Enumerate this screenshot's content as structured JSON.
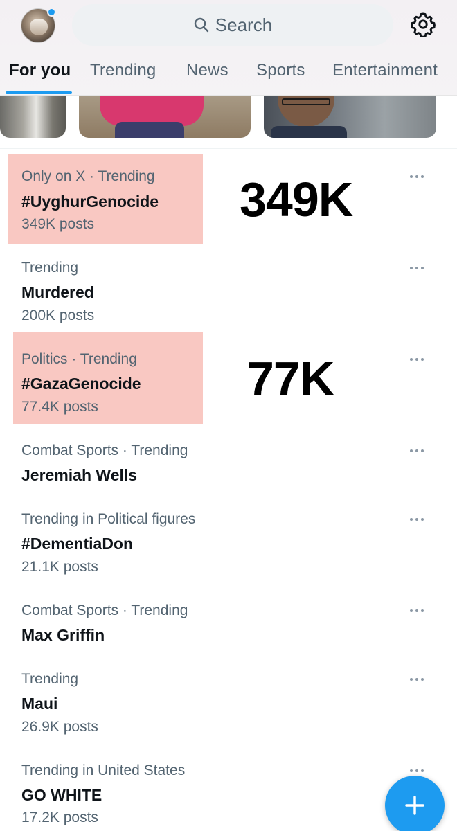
{
  "search": {
    "placeholder": "Search"
  },
  "tabs": [
    {
      "label": "For you",
      "active": true
    },
    {
      "label": "Trending",
      "active": false
    },
    {
      "label": "News",
      "active": false
    },
    {
      "label": "Sports",
      "active": false
    },
    {
      "label": "Entertainment",
      "active": false
    }
  ],
  "trends": [
    {
      "context": "Only on X · Trending",
      "topic": "#UyghurGenocide",
      "count": "349K posts",
      "highlighted": true
    },
    {
      "context": "Trending",
      "topic": "Murdered",
      "count": "200K posts",
      "highlighted": false
    },
    {
      "context": "Politics · Trending",
      "topic": "#GazaGenocide",
      "count": "77.4K posts",
      "highlighted": true
    },
    {
      "context": "Combat Sports · Trending",
      "topic": "Jeremiah Wells",
      "count": "",
      "highlighted": false
    },
    {
      "context": "Trending in Political figures",
      "topic": "#DementiaDon",
      "count": "21.1K posts",
      "highlighted": false
    },
    {
      "context": "Combat Sports · Trending",
      "topic": "Max Griffin",
      "count": "",
      "highlighted": false
    },
    {
      "context": "Trending",
      "topic": "Maui",
      "count": "26.9K posts",
      "highlighted": false
    },
    {
      "context": "Trending in United States",
      "topic": "GO WHITE",
      "count": "17.2K posts",
      "highlighted": false
    }
  ],
  "annotations": {
    "first": "349K",
    "second": "77K"
  },
  "colors": {
    "accent": "#1d9bf0",
    "highlight": "#f9c8c2",
    "secondary_text": "#536471",
    "primary_text": "#0f1419"
  },
  "icons": {
    "search": "search-icon",
    "settings": "gear-icon",
    "more": "more-dots-icon",
    "compose": "plus-icon"
  }
}
